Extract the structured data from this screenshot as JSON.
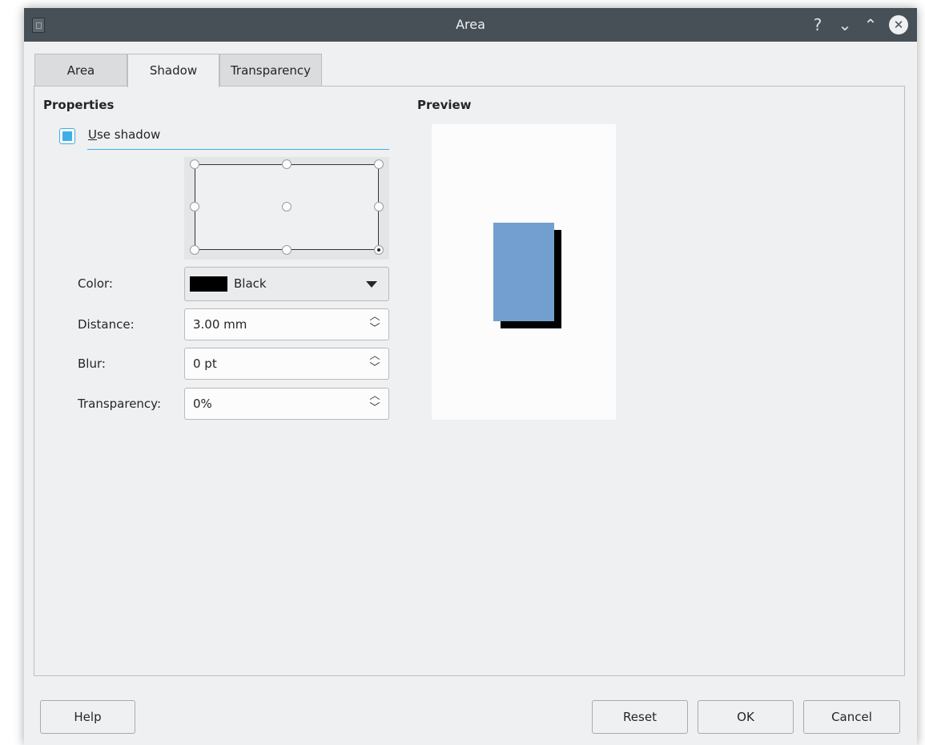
{
  "window": {
    "title": "Area"
  },
  "titlebar": {
    "help_glyph": "?",
    "minimize_glyph": "⌄",
    "maximize_glyph": "⌃",
    "close_glyph": "✕"
  },
  "tabs": [
    {
      "label": "Area",
      "active": false
    },
    {
      "label": "Shadow",
      "active": true
    },
    {
      "label": "Transparency",
      "active": false
    }
  ],
  "properties": {
    "heading": "Properties",
    "use_shadow": {
      "label": "Use shadow",
      "checked": true
    },
    "color": {
      "label": "Color:",
      "value": "Black",
      "swatch": "#000000"
    },
    "distance": {
      "label": "Distance:",
      "value": "3.00 mm"
    },
    "blur": {
      "label": "Blur:",
      "value": "0 pt"
    },
    "transparency": {
      "label": "Transparency:",
      "value": "0%"
    }
  },
  "preview": {
    "heading": "Preview",
    "object_color": "#729fcf",
    "shadow_color": "#000000"
  },
  "buttons": {
    "help": "Help",
    "reset": "Reset",
    "ok": "OK",
    "cancel": "Cancel"
  },
  "colors": {
    "accent": "#3daee9",
    "titlebar": "#475057",
    "window_bg": "#eff0f1"
  }
}
